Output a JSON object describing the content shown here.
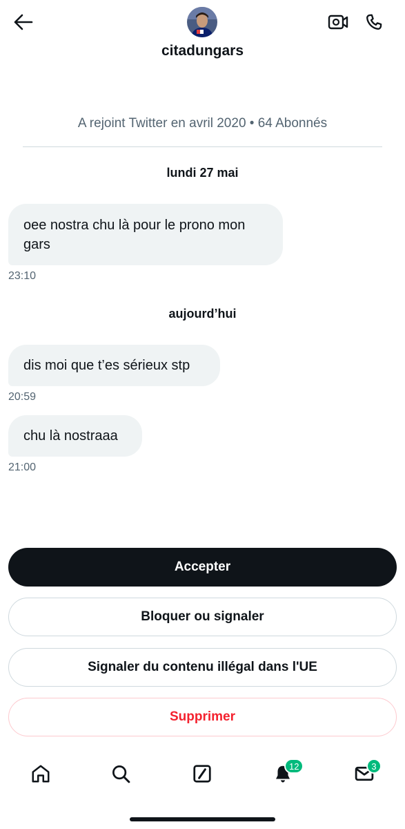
{
  "header": {
    "username": "citadungars",
    "back_icon": "arrow-left-icon",
    "video_icon": "video-camera-icon",
    "call_icon": "phone-icon"
  },
  "profile_info": "A rejoint Twitter en avril 2020 • 64 Abonnés",
  "conversation": {
    "date_1": "lundi 27 mai",
    "message_1": "oee nostra chu là pour le prono mon gars",
    "time_1": "23:10",
    "date_2": "aujourd’hui",
    "message_2": "dis moi que t’es sérieux stp",
    "time_2": "20:59",
    "message_3": "chu là nostraaa",
    "time_3": "21:00"
  },
  "actions": {
    "accept": "Accepter",
    "block_report": "Bloquer ou signaler",
    "report_illegal": "Signaler du contenu illégal dans l'UE",
    "delete": "Supprimer"
  },
  "nav": {
    "notifications_badge": "12",
    "messages_badge": "3"
  },
  "colors": {
    "accent_dark": "#0f1419",
    "secondary_text": "#536471",
    "bubble_bg": "#eff3f4",
    "danger": "#f4212e",
    "badge": "#00ba7c"
  }
}
